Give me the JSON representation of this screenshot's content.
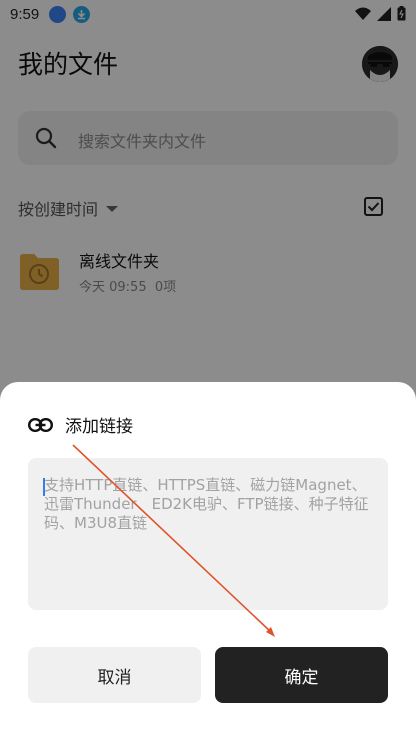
{
  "status_bar": {
    "time": "9:59",
    "app_icons": [
      {
        "name": "browser-app-icon",
        "color": "#3b82f6"
      },
      {
        "name": "download-app-icon",
        "color": "#29a8e8"
      }
    ],
    "indicators": [
      "wifi-icon",
      "signal-icon",
      "battery-icon"
    ]
  },
  "header": {
    "title": "我的文件",
    "avatar_icon": "sunglasses-avatar"
  },
  "search": {
    "placeholder": "搜索文件夹内文件",
    "icon": "search-icon"
  },
  "sort": {
    "label": "按创建时间"
  },
  "files": [
    {
      "name": "离线文件夹",
      "date": "今天 09:55",
      "count": "0项",
      "icon": "offline-folder-icon",
      "color": "#e8b14a"
    }
  ],
  "dialog": {
    "title": "添加链接",
    "title_icon": "link-icon",
    "placeholder": "支持HTTP直链、HTTPS直链、磁力链Magnet、迅雷Thunder、ED2K电驴、FTP链接、种子特征码、M3U8直链",
    "cancel_label": "取消",
    "confirm_label": "确定"
  },
  "colors": {
    "overlay": "rgba(0,0,0,0.45)",
    "confirm_bg": "#222222",
    "annotation_arrow": "#e0532a"
  }
}
